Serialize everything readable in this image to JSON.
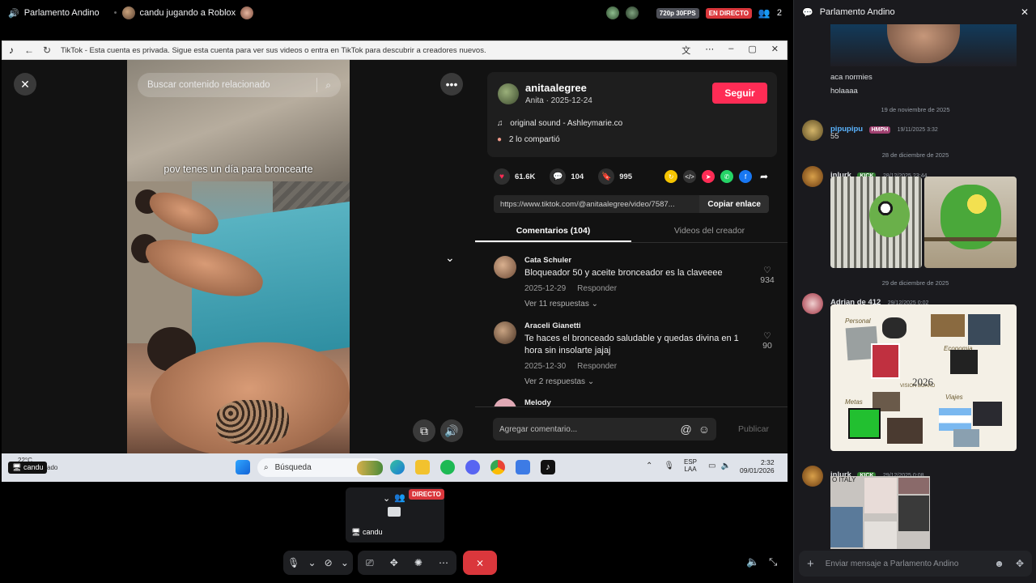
{
  "topbar": {
    "channel": "Parlamento Andino",
    "stream_title": "candu jugando a Roblox",
    "quality": "720p 30FPS",
    "live": "EN DIRECTO",
    "viewers": "2"
  },
  "browser": {
    "tab_text": "TikTok - Esta cuenta es privada. Sigue esta cuenta para ver sus videos o entra en TikTok para descubrir a creadores nuevos."
  },
  "tiktok": {
    "search_placeholder": "Buscar contenido relacionado",
    "overlay_text": "pov tenes un día para broncearte",
    "author": {
      "username": "anitaalegree",
      "subtitle": "Anita · 2025-12-24",
      "follow": "Seguir",
      "sound": "original sound - Ashleymarie.co",
      "shared": "2 lo compartió"
    },
    "stats": {
      "likes": "61.6K",
      "comments": "104",
      "saves": "995"
    },
    "link": "https://www.tiktok.com/@anitaalegree/video/7587...",
    "copy_link": "Copiar enlace",
    "tabs": [
      "Comentarios (104)",
      "Videos del creador"
    ],
    "comments": [
      {
        "name": "Cata Schuler",
        "text": "Bloqueador 50 y aceite bronceador es la claveeee",
        "date": "2025-12-29",
        "reply": "Responder",
        "likes": "934",
        "more": "Ver 11 respuestas"
      },
      {
        "name": "Araceli Gianetti",
        "text": "Te haces el bronceado saludable y quedas divina en 1 hora sin insolarte jajaj",
        "date": "2025-12-30",
        "reply": "Responder",
        "likes": "90",
        "more": "Ver 2 respuestas"
      },
      {
        "name": "Melody"
      }
    ],
    "comment_placeholder": "Agregar comentario...",
    "publish": "Publicar"
  },
  "taskbar": {
    "weather_temp": "22°C",
    "weather_desc": "Parc. nublado",
    "streamer": "candu",
    "search": "Búsqueda",
    "lang": "ESP",
    "lang2": "LAA",
    "time": "2:32",
    "date": "09/01/2026"
  },
  "tile": {
    "name": "candu",
    "live": "DIRECTO"
  },
  "chat": {
    "title": "Parlamento Andino",
    "msgs_top": [
      "aca normies",
      "holaaaa"
    ],
    "sep1": "19 de noviembre de 2025",
    "m1": {
      "user": "pipupipu",
      "role": "HMPH",
      "time": "19/11/2025 3:32",
      "text": "55",
      "color": "#5ab4ff"
    },
    "sep2": "28 de diciembre de 2025",
    "m2": {
      "user": "inlurk",
      "role": "KICK",
      "time": "28/12/2025 23:44",
      "color": "#dbdee1"
    },
    "sep3": "29 de diciembre de 2025",
    "m3": {
      "user": "Adrian de 412",
      "time": "29/12/2025 0:02",
      "color": "#dbdee1"
    },
    "board": {
      "labels": [
        "Personal",
        "Economia",
        "VISION BOARD",
        "2026",
        "Metas",
        "Viajes"
      ]
    },
    "m4": {
      "user": "inlurk",
      "role": "KICK",
      "time": "29/12/2025 0:08",
      "color": "#dbdee1",
      "collage_text": "O ITALY"
    },
    "input_placeholder": "Enviar mensaje a Parlamento Andino"
  }
}
